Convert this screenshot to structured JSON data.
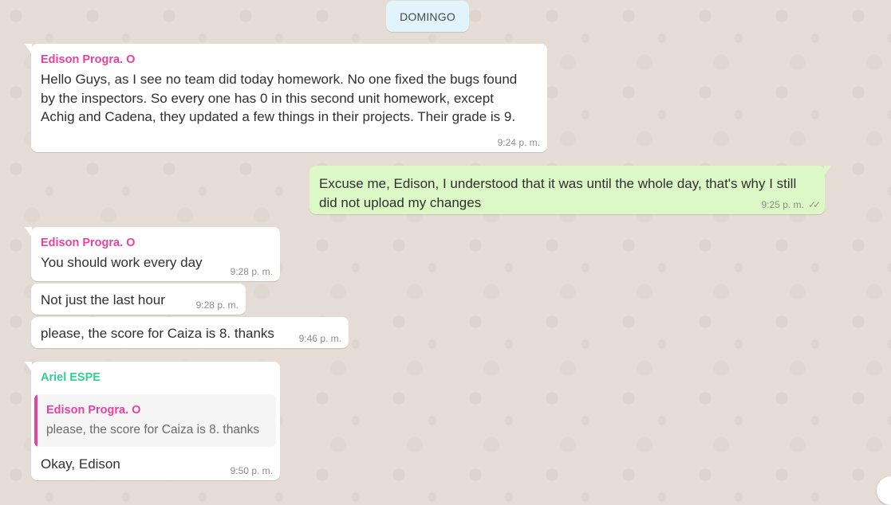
{
  "date_chip": "DOMINGO",
  "messages": [
    {
      "direction": "in",
      "sender": "Edison Progra. O",
      "text": "Hello Guys, as I see no team did today homework. No one fixed the bugs found\nby the inspectors. So every one has 0 in this second unit homework, except\nAchig and Cadena, they updated a few things in their projects. Their grade is 9.",
      "time": "9:24 p. m."
    },
    {
      "direction": "out",
      "text": "Excuse me, Edison, I understood that it was until the whole day, that's why I still\ndid not upload my changes",
      "time": "9:25 p. m.",
      "status_icon": "double-check-icon"
    },
    {
      "direction": "in",
      "sender": "Edison Progra. O",
      "text": "You should work every day",
      "time": "9:28 p. m."
    },
    {
      "direction": "in",
      "text": "Not just the last hour",
      "time": "9:28 p. m."
    },
    {
      "direction": "in",
      "text": "please, the score for Caiza is 8. thanks",
      "time": "9:46 p. m."
    },
    {
      "direction": "in",
      "sender": "Ariel ESPE",
      "quoted": {
        "sender": "Edison Progra. O",
        "text": "please, the score for Caiza is 8. thanks"
      },
      "text": "Okay, Edison",
      "time": "9:50 p. m."
    }
  ],
  "colors": {
    "background": "#e5ddd5",
    "incoming_bubble": "#ffffff",
    "outgoing_bubble": "#dcf8c6",
    "date_chip": "#e1f3fb",
    "sender_edison": "#e542a3",
    "sender_ariel": "#35cd96"
  }
}
